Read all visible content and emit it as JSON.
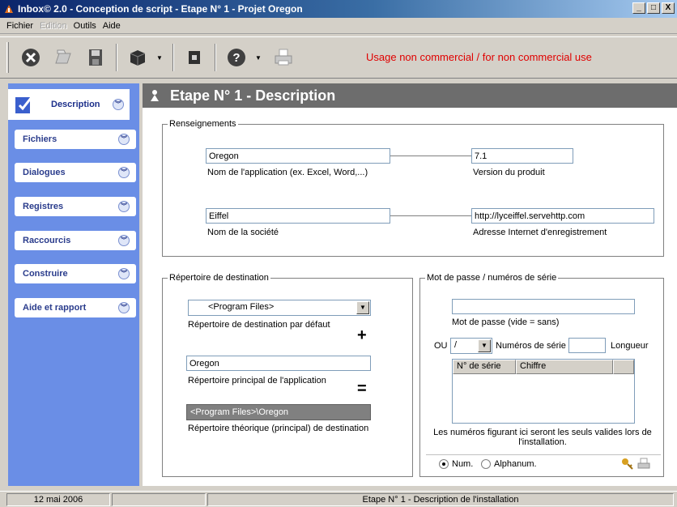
{
  "window": {
    "title": "Inbox© 2.0 - Conception de script - Etape N° 1 - Projet Oregon",
    "controls": {
      "minimize": "_",
      "maximize": "□",
      "close": "X"
    }
  },
  "menu": [
    {
      "label": "Fichier",
      "disabled": false
    },
    {
      "label": "Edition",
      "disabled": true
    },
    {
      "label": "Outils",
      "disabled": false
    },
    {
      "label": "Aide",
      "disabled": false
    }
  ],
  "toolbar": {
    "license_notice": "Usage non commercial / for non commercial use",
    "buttons": [
      "close-icon",
      "open-icon",
      "save-icon",
      "package-icon",
      "build-icon",
      "help-icon",
      "print-icon"
    ]
  },
  "sidebar": {
    "active": "Description",
    "items": [
      "Fichiers",
      "Dialogues",
      "Registres",
      "Raccourcis",
      "Construire",
      "Aide et rapport"
    ]
  },
  "step": {
    "title": "Etape N° 1 - Description"
  },
  "renseignements": {
    "legend": "Renseignements",
    "app_name": "Oregon",
    "app_name_label": "Nom de l'application  (ex. Excel, Word,...)",
    "version": "7.1",
    "version_label": "Version du produit",
    "company": "Eiffel",
    "company_label": "Nom de la société",
    "url": "http://lyceiffel.servehttp.com",
    "url_label": "Adresse Internet d'enregistrement"
  },
  "destination": {
    "legend": "Répertoire de destination",
    "default_dir": "<Program Files>",
    "default_dir_label": "Répertoire de destination par défaut",
    "plus": "+",
    "main_dir": "Oregon",
    "main_dir_label": "Répertoire principal de l'application",
    "equals": "=",
    "result": "<Program Files>\\Oregon",
    "result_label": "Répertoire théorique (principal) de destination"
  },
  "password": {
    "legend": "Mot de passe / numéros de série",
    "password_value": "",
    "password_label": "Mot de passe (vide = sans)",
    "or_label": "OU",
    "separator_value": "/",
    "serial_label": "Numéros de série",
    "length_value": "",
    "length_label": "Longueur",
    "columns": [
      "N° de série",
      "Chiffre"
    ],
    "note": "Les numéros figurant ici seront les seuls valides lors de l'installation.",
    "radio_num": "Num.",
    "radio_alpha": "Alphanum.",
    "selected": "Num."
  },
  "status": {
    "date": "12 mai 2006",
    "message": "Etape N° 1 - Description de l'installation"
  },
  "colors": {
    "sidebar_bg": "#6a8ee6",
    "header_bg": "#6d6d6d",
    "license": "#e00000"
  }
}
